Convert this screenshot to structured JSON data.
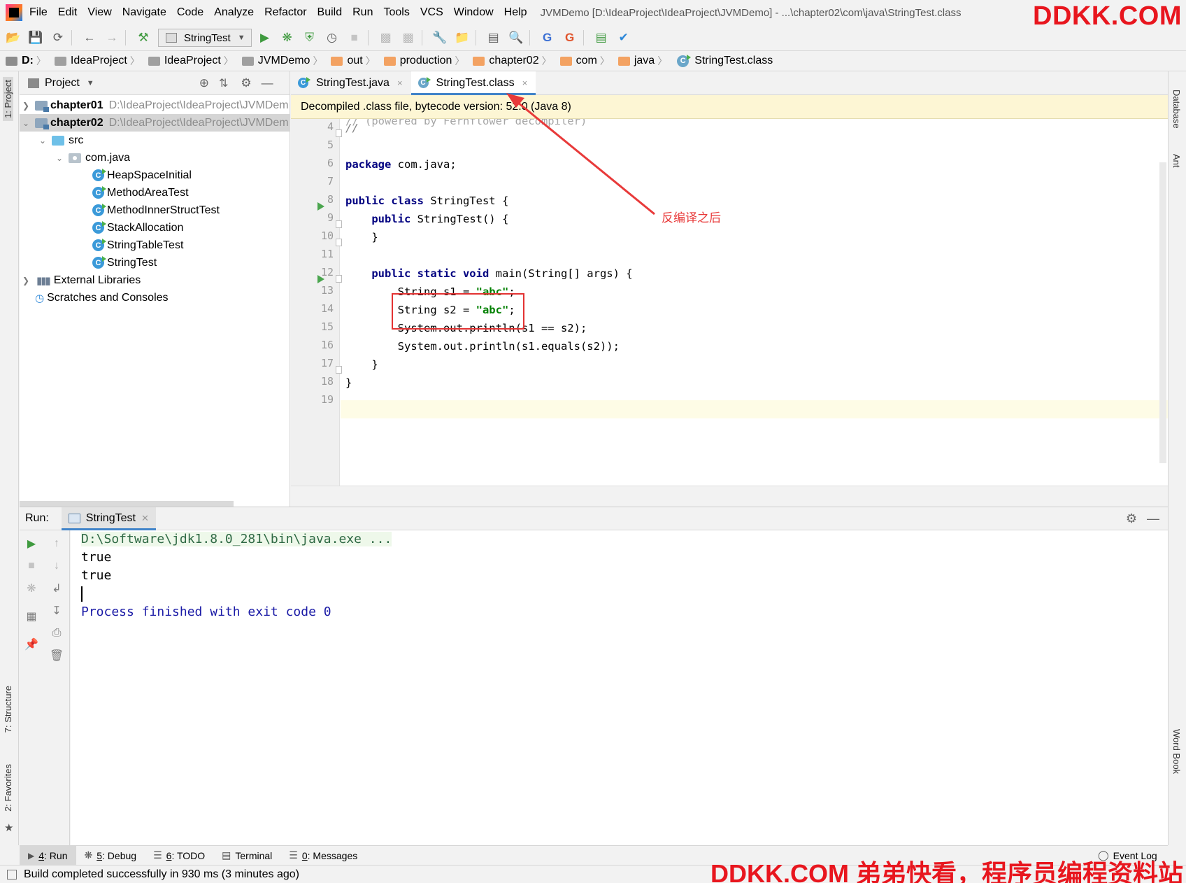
{
  "menubar": {
    "items": [
      "File",
      "Edit",
      "View",
      "Navigate",
      "Code",
      "Analyze",
      "Refactor",
      "Build",
      "Run",
      "Tools",
      "VCS",
      "Window",
      "Help"
    ],
    "title": "JVMDemo [D:\\IdeaProject\\IdeaProject\\JVMDemo] - ...\\chapter02\\com\\java\\StringTest.class"
  },
  "watermark_top": "DDKK.COM",
  "toolbar": {
    "run_config": "StringTest",
    "icons": [
      "open-icon",
      "save-icon",
      "sync-icon",
      "back-icon",
      "forward-icon",
      "build-icon",
      "run-icon",
      "debug-icon",
      "coverage-icon",
      "profile-icon",
      "stop-icon",
      "settings-icon",
      "project-structure-icon",
      "terminal-icon",
      "search-icon",
      "translate-icon",
      "metrics-icon",
      "check-icon"
    ]
  },
  "breadcrumb": [
    "D:",
    "IdeaProject",
    "IdeaProject",
    "JVMDemo",
    "out",
    "production",
    "chapter02",
    "com",
    "java",
    "StringTest.class"
  ],
  "left_strip": {
    "project_tab": "1: Project",
    "structure_tab": "7: Structure",
    "favorites_tab": "2: Favorites"
  },
  "right_strip": {
    "database_tab": "Database",
    "ant_tab": "Ant",
    "wordbook_tab": "Word Book"
  },
  "project_panel": {
    "title": "Project",
    "tree": [
      {
        "label": "chapter01",
        "path": "D:\\IdeaProject\\IdeaProject\\JVMDem"
      },
      {
        "label": "chapter02",
        "path": "D:\\IdeaProject\\IdeaProject\\JVMDem"
      },
      {
        "label": "src"
      },
      {
        "label": "com.java"
      },
      {
        "label": "HeapSpaceInitial"
      },
      {
        "label": "MethodAreaTest"
      },
      {
        "label": "MethodInnerStructTest"
      },
      {
        "label": "StackAllocation"
      },
      {
        "label": "StringTableTest"
      },
      {
        "label": "StringTest"
      },
      {
        "label": "External Libraries"
      },
      {
        "label": "Scratches and Consoles"
      }
    ]
  },
  "editor": {
    "tabs": [
      {
        "label": "StringTest.java",
        "close": "×"
      },
      {
        "label": "StringTest.class",
        "close": "×"
      }
    ],
    "banner": "Decompiled .class file, bytecode version: 52.0 (Java 8)",
    "line_numbers": [
      "4",
      "5",
      "6",
      "7",
      "8",
      "9",
      "10",
      "11",
      "12",
      "13",
      "14",
      "15",
      "16",
      "17",
      "18",
      "19"
    ],
    "annotation": "反编译之后"
  },
  "run_panel": {
    "label": "Run:",
    "tab": "StringTest",
    "console": {
      "command": "D:\\Software\\jdk1.8.0_281\\bin\\java.exe ...",
      "out1": "true",
      "out2": "true",
      "exit": "Process finished with exit code 0"
    }
  },
  "tool_tabs": [
    {
      "num": "4",
      "label": ": Run"
    },
    {
      "num": "5",
      "label": ": Debug"
    },
    {
      "num": "6",
      "label": ": TODO"
    },
    {
      "num": "",
      "label": "Terminal"
    },
    {
      "num": "0",
      "label": ": Messages"
    }
  ],
  "event_log": "Event Log",
  "status": "Build completed successfully in 930 ms (3 minutes ago)",
  "watermark_bottom": "DDKK.COM 弟弟快看，程序员编程资料站",
  "colors": {
    "accent": "#4083c9",
    "keyword": "#000080",
    "string": "#008000",
    "annotation": "#e83a3a",
    "watermark": "#e8161e"
  }
}
